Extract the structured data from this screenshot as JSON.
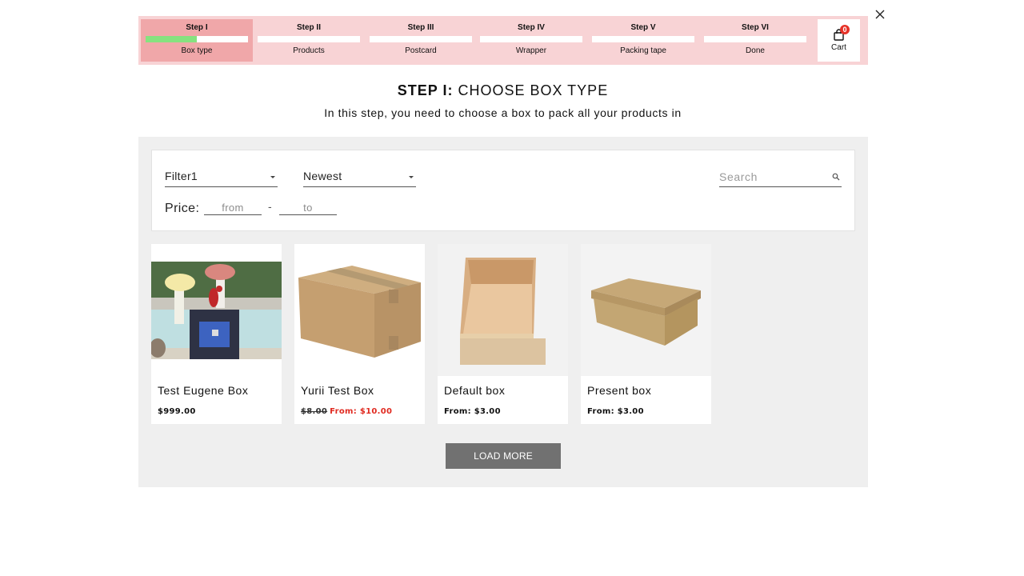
{
  "stepper": {
    "steps": [
      {
        "title": "Step I",
        "label": "Box type",
        "active": true,
        "progress": 0.5
      },
      {
        "title": "Step II",
        "label": "Products",
        "active": false,
        "progress": 0
      },
      {
        "title": "Step III",
        "label": "Postcard",
        "active": false,
        "progress": 0
      },
      {
        "title": "Step IV",
        "label": "Wrapper",
        "active": false,
        "progress": 0
      },
      {
        "title": "Step V",
        "label": "Packing tape",
        "active": false,
        "progress": 0
      },
      {
        "title": "Step VI",
        "label": "Done",
        "active": false,
        "progress": 0
      }
    ],
    "cart": {
      "label": "Cart",
      "count": "0"
    }
  },
  "heading": {
    "step": "STEP I:",
    "title": "CHOOSE BOX TYPE",
    "subtitle": "In this step, you need to choose a box to pack all your products in"
  },
  "filters": {
    "filter_select": {
      "value": "Filter1"
    },
    "sort_select": {
      "value": "Newest"
    },
    "search": {
      "placeholder": "Search",
      "value": ""
    },
    "price": {
      "label": "Price:",
      "from_placeholder": "from",
      "to_placeholder": "to",
      "separator": "-"
    }
  },
  "products": [
    {
      "name": "Test Eugene Box",
      "price": "$999.00",
      "old_price": "",
      "sale_price": "",
      "image": "parrot-on-box-photo"
    },
    {
      "name": "Yurii Test Box",
      "price": "",
      "old_price": "$8.00",
      "sale_price": "From: $10.00",
      "image": "cardboard-shipping-box-photo"
    },
    {
      "name": "Default box",
      "price": "From: $3.00",
      "old_price": "",
      "sale_price": "",
      "image": "open-tray-box-photo"
    },
    {
      "name": "Present box",
      "price": "From: $3.00",
      "old_price": "",
      "sale_price": "",
      "image": "lidded-kraft-box-photo"
    }
  ],
  "load_more_label": "LOAD MORE",
  "colors": {
    "stepper_bg": "#f8d3d5",
    "step_active_bg": "#f0a7a9",
    "progress_fill": "#86e27f",
    "sale_red": "#e02a20",
    "cart_badge": "#e63228",
    "panel_bg": "#efefef",
    "button_bg": "#717171"
  }
}
